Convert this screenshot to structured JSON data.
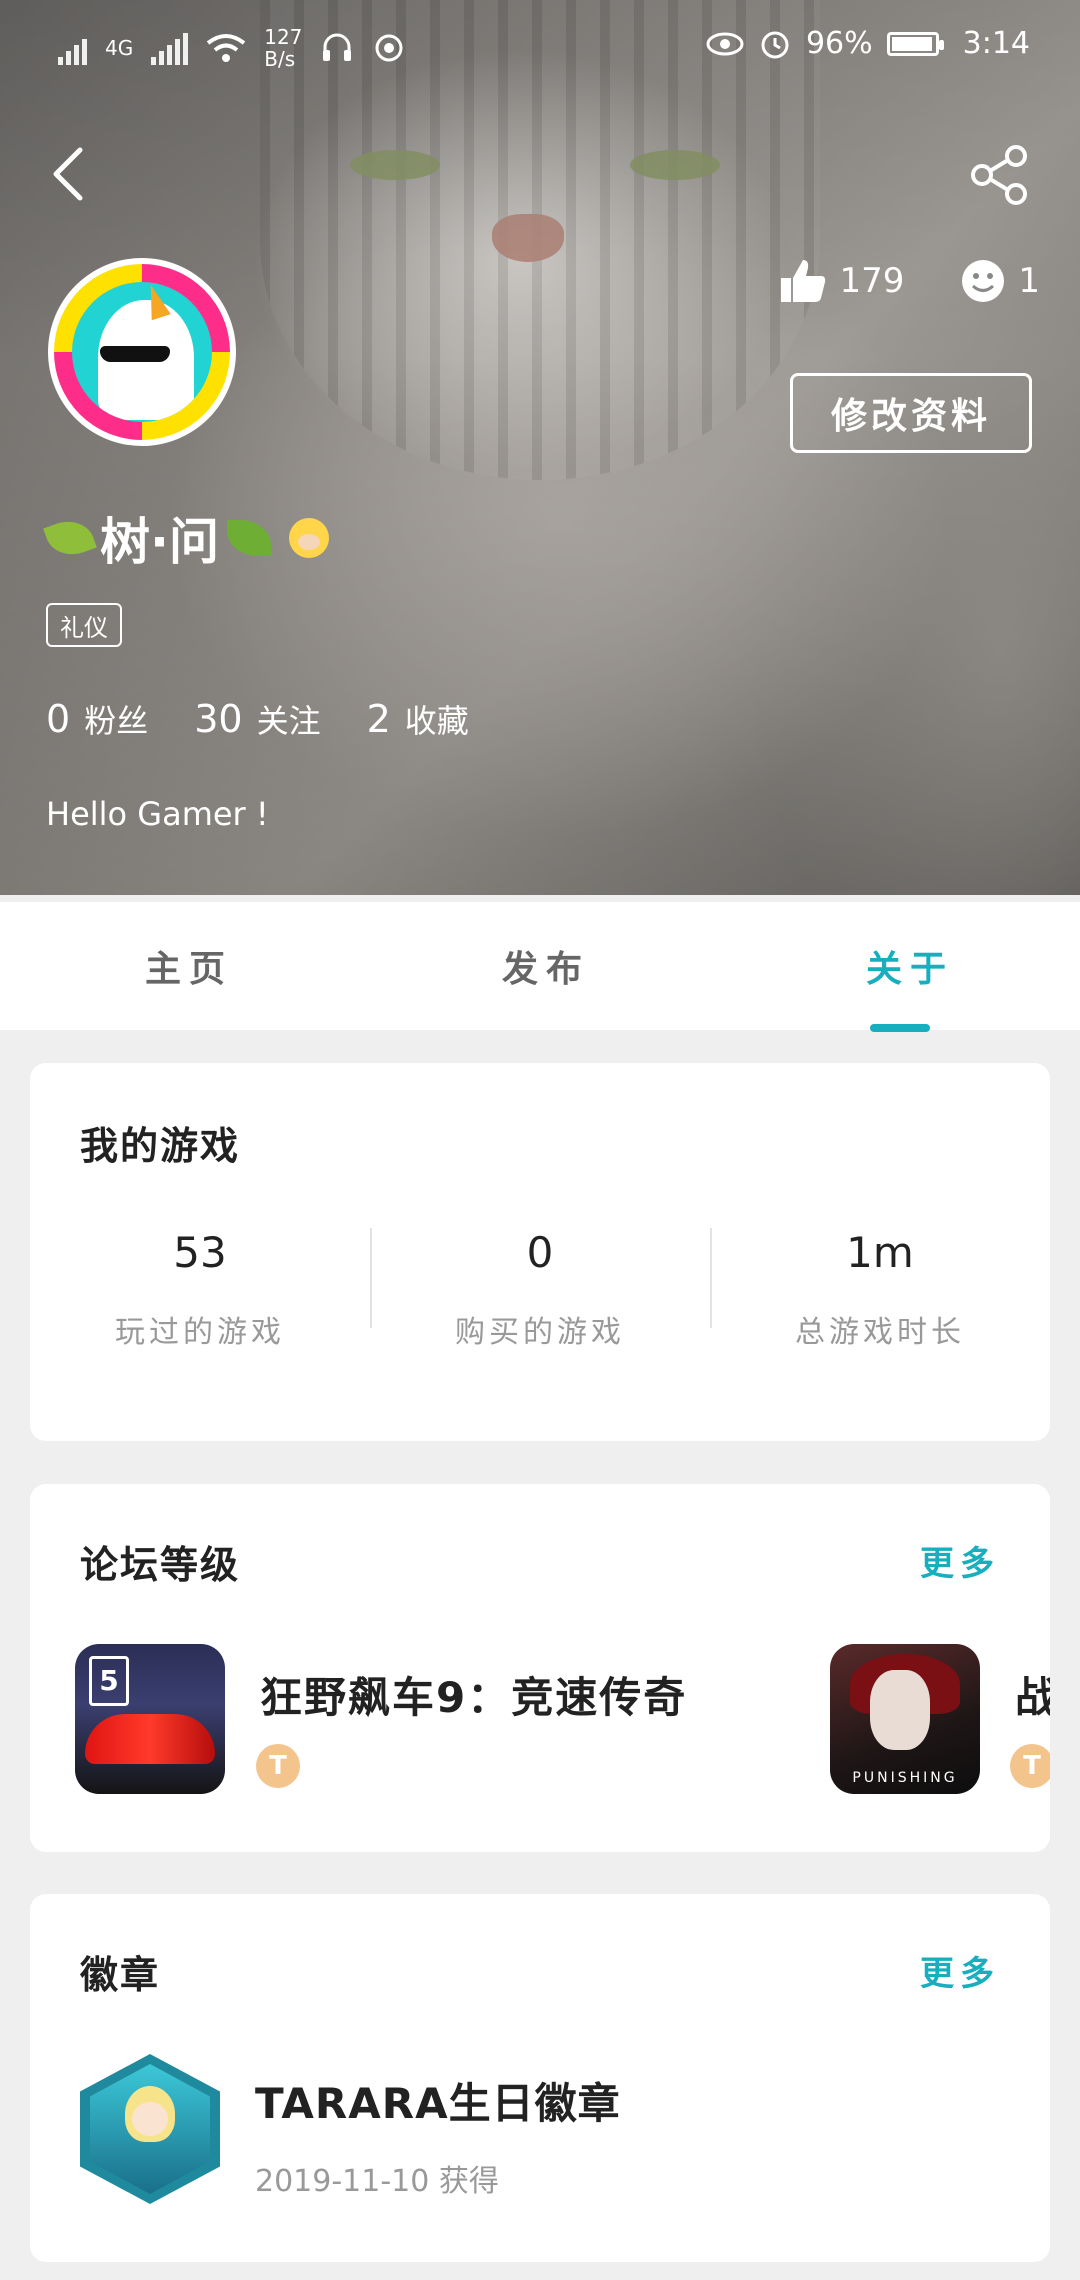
{
  "status": {
    "network": "4G",
    "speed_value": "127",
    "speed_unit": "B/s",
    "battery": "96%",
    "battery_level": 0.96,
    "time": "3:14"
  },
  "header": {
    "likes": "179",
    "visitors": "1",
    "edit_label": "修改资料"
  },
  "profile": {
    "name": "树·问",
    "tag": "礼仪",
    "fans_count": "0",
    "fans_label": "粉丝",
    "following_count": "30",
    "following_label": "关注",
    "collect_count": "2",
    "collect_label": "收藏",
    "bio": "Hello Gamer !"
  },
  "tabs": [
    {
      "label": "主页"
    },
    {
      "label": "发布"
    },
    {
      "label": "关于"
    }
  ],
  "my_games": {
    "title": "我的游戏",
    "stats": [
      {
        "value": "53",
        "label": "玩过的游戏"
      },
      {
        "value": "0",
        "label": "购买的游戏"
      },
      {
        "value": "1m",
        "label": "总游戏时长"
      }
    ]
  },
  "forum": {
    "title": "论坛等级",
    "more": "更多",
    "items": [
      {
        "name": "狂野飙车9：竞速传奇",
        "icon_text": "5",
        "level": "T"
      },
      {
        "name": "战",
        "icon_text": "PUNISHING",
        "level": "T"
      }
    ]
  },
  "badges": {
    "title": "徽章",
    "more": "更多",
    "items": [
      {
        "name": "TARARA生日徽章",
        "date": "2019-11-10 获得"
      }
    ]
  }
}
